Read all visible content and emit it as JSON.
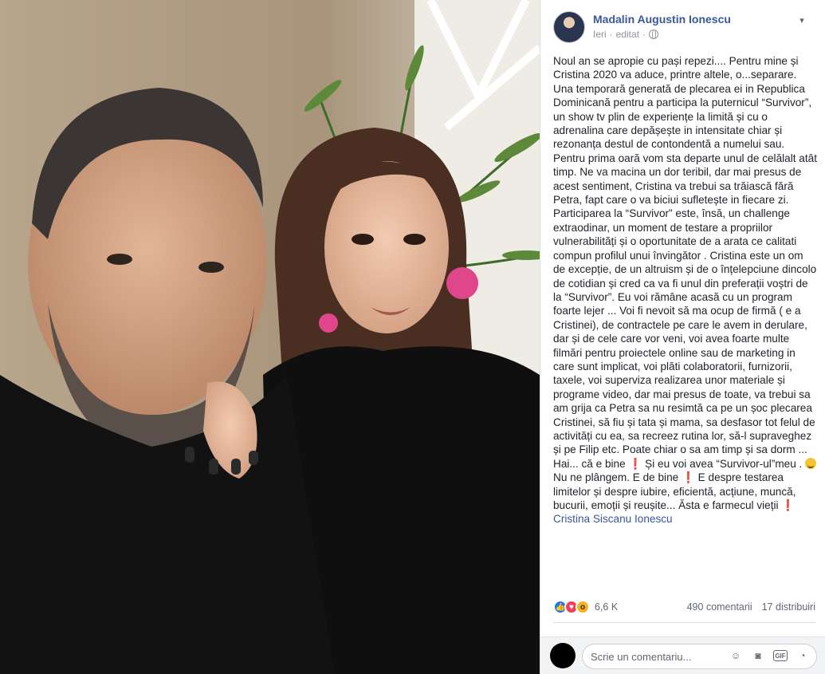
{
  "post": {
    "author": "Madalin Augustin Ionescu",
    "time": "Ieri",
    "edited": "editat",
    "text_before_emoji": "Noul an se apropie cu pași repezi.... Pentru mine și Cristina 2020 va aduce, printre altele, o...separare. Una temporară generată de plecarea ei in Republica Dominicană pentru a participa la puternicul “Survivor”, un show tv plin de experiențe la limită și cu o adrenalina care depășește in intensitate chiar și rezonanța destul de contondentă a numelui sau. Pentru prima oară vom sta departe unul de celălalt atât timp. Ne va macina un dor teribil, dar mai presus de acest sentiment, Cristina va trebui sa trăiască fără Petra, fapt care o va biciui sufletește in fiecare zi. Participarea la “Survivor” este, însă, un challenge extraodinar, un moment de testare a propriilor vulnerabilități și o oportunitate de a arata ce calitati compun profilul unui învingător . Cristina este un om de excepție, de un altruism și de o înțelepciune dincolo de cotidian și cred ca va fi unul din preferații voștri de la “Survivor”. Eu voi rămâne acasă cu un program foarte lejer ... Voi fi nevoit să ma ocup de firmă ( e a Cristinei), de contractele pe care le avem in derulare, dar și de cele care vor veni, voi avea foarte multe filmări pentru proiectele online sau de marketing in care sunt implicat, voi plăti colaboratorii, furnizorii, taxele, voi superviza realizarea unor materiale și programe video, dar mai presus de toate, va trebui sa am grija ca Petra sa nu resimtă ca pe un șoc plecarea Cristinei, să fiu și tata și mama, sa desfasor tot felul de activități cu ea, sa recreez rutina lor, să-l supraveghez și pe Filip etc. Poate chiar o sa am timp și sa dorm ... Hai... că e bine ❗ Și eu voi avea “Survivor-ul”meu .",
    "text_after_emoji": " Nu ne plângem. E de bine ❗ E despre testarea limitelor și despre iubire, eficientă, acțiune, muncă, bucurii, emoții și reușite... Ăsta e farmecul vieții ❗",
    "tagged": "Cristina Siscanu Ionescu"
  },
  "stats": {
    "reactions_count": "6,6 K",
    "comments": "490 comentarii",
    "shares": "17 distribuiri"
  },
  "comment_box": {
    "placeholder": "Scrie un comentariu..."
  },
  "icons": [
    "like-icon",
    "love-icon",
    "wow-icon",
    "emoji-icon",
    "camera-icon",
    "gif-icon",
    "sticker-icon",
    "globe-icon",
    "chevron-down-icon"
  ],
  "colors": {
    "link": "#385898",
    "text": "#1d2129",
    "muted": "#90949c",
    "like": "#1877f2",
    "love": "#f33e58",
    "wow": "#f7b125"
  }
}
